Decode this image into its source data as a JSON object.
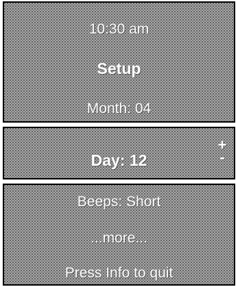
{
  "time": "10:30 am",
  "setup_title": "Setup",
  "month_item": "Month: 04",
  "day_item": "Day: 12",
  "adjust": {
    "plus": "+",
    "minus": "-"
  },
  "beeps_item": "Beeps: Short",
  "more_item": "...more...",
  "footer_hint": "Press Info to quit"
}
